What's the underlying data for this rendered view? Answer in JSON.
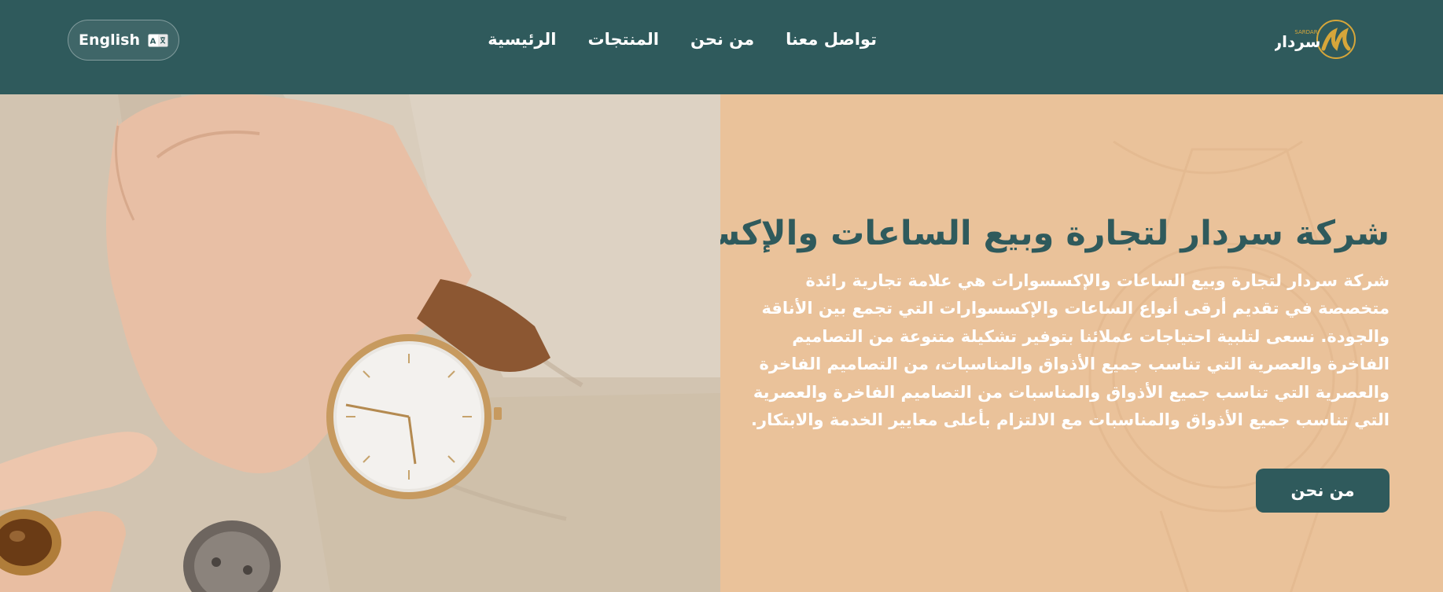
{
  "header": {
    "language_button": "English",
    "nav": [
      {
        "label": "الرئيسية"
      },
      {
        "label": "المنتجات"
      },
      {
        "label": "من نحن"
      },
      {
        "label": "تواصل معنا"
      }
    ],
    "logo_text_ar": "سردار",
    "logo_text_en": "SARDAR"
  },
  "hero": {
    "title": "شركة سردار لتجارة وبيع الساعات والإكسسوارات",
    "description": "شركة سردار لتجارة وبيع الساعات والإكسسوارات هي علامة تجارية رائدة متخصصة في تقديم أرقى أنواع الساعات والإكسسوارات التي تجمع بين الأناقة والجودة. نسعى لتلبية احتياجات عملائنا بتوفير تشكيلة متنوعة من التصاميم الفاخرة والعصرية التي تناسب جميع الأذواق والمناسبات، من التصاميم الفاخرة والعصرية التي تناسب جميع الأذواق والمناسبات من التصاميم الفاخرة والعصرية التي تناسب جميع الأذواق والمناسبات مع الالتزام بأعلى معايير الخدمة والابتكار.",
    "button_label": "من نحن"
  },
  "colors": {
    "header_bg": "#2f5a5c",
    "hero_panel_bg": "#eac29a",
    "accent": "#2f5a5c",
    "logo_gold": "#d6a63a"
  }
}
